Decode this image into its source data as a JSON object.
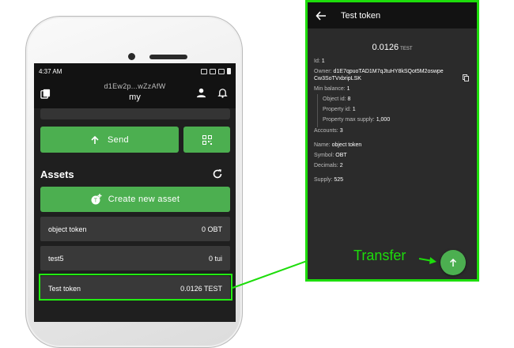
{
  "status": {
    "time": "4:37 AM"
  },
  "header": {
    "address": "d1Ew2p...wZzAfW",
    "wallet_name": "my"
  },
  "actions": {
    "send_label": "Send",
    "create_label": "Create new asset"
  },
  "assets": {
    "title": "Assets",
    "rows": [
      {
        "name": "object token",
        "amount": "0 OBT"
      },
      {
        "name": "test5",
        "amount": "0 tui"
      },
      {
        "name": "Test token",
        "amount": "0.0126 TEST"
      }
    ]
  },
  "panel": {
    "title": "Test token",
    "balance_value": "0.0126",
    "balance_symbol": "TEST",
    "id_label": "Id:",
    "id": "1",
    "owner_label": "Owner:",
    "owner_line1": "d1E7qpuoTAD1M7qJtuHY8kSQot5M2oswpe",
    "owner_line2": "Cw3SoTVxbripLSK",
    "min_balance_label": "Min balance:",
    "min_balance": "1",
    "object_id_label": "Object id:",
    "object_id": "8",
    "property_id_label": "Property id:",
    "property_id": "1",
    "property_max_label": "Property max supply:",
    "property_max": "1,000",
    "accounts_label": "Accounts:",
    "accounts": "3",
    "name_label": "Name:",
    "name": "object token",
    "symbol_label": "Symbol:",
    "symbol": "OBT",
    "decimals_label": "Decimals:",
    "decimals": "2",
    "supply_label": "Supply:",
    "supply": "525"
  },
  "annotation": {
    "transfer_label": "Transfer"
  },
  "colors": {
    "accent_green": "#4caf50",
    "highlight_green": "#1ddd0b",
    "background_dark": "#1f1f1f"
  },
  "icons": [
    "wallet-icon",
    "person-icon",
    "bell-icon",
    "arrow-up-icon",
    "qr-code-icon",
    "refresh-icon",
    "token-add-icon",
    "back-arrow-icon",
    "copy-icon"
  ]
}
